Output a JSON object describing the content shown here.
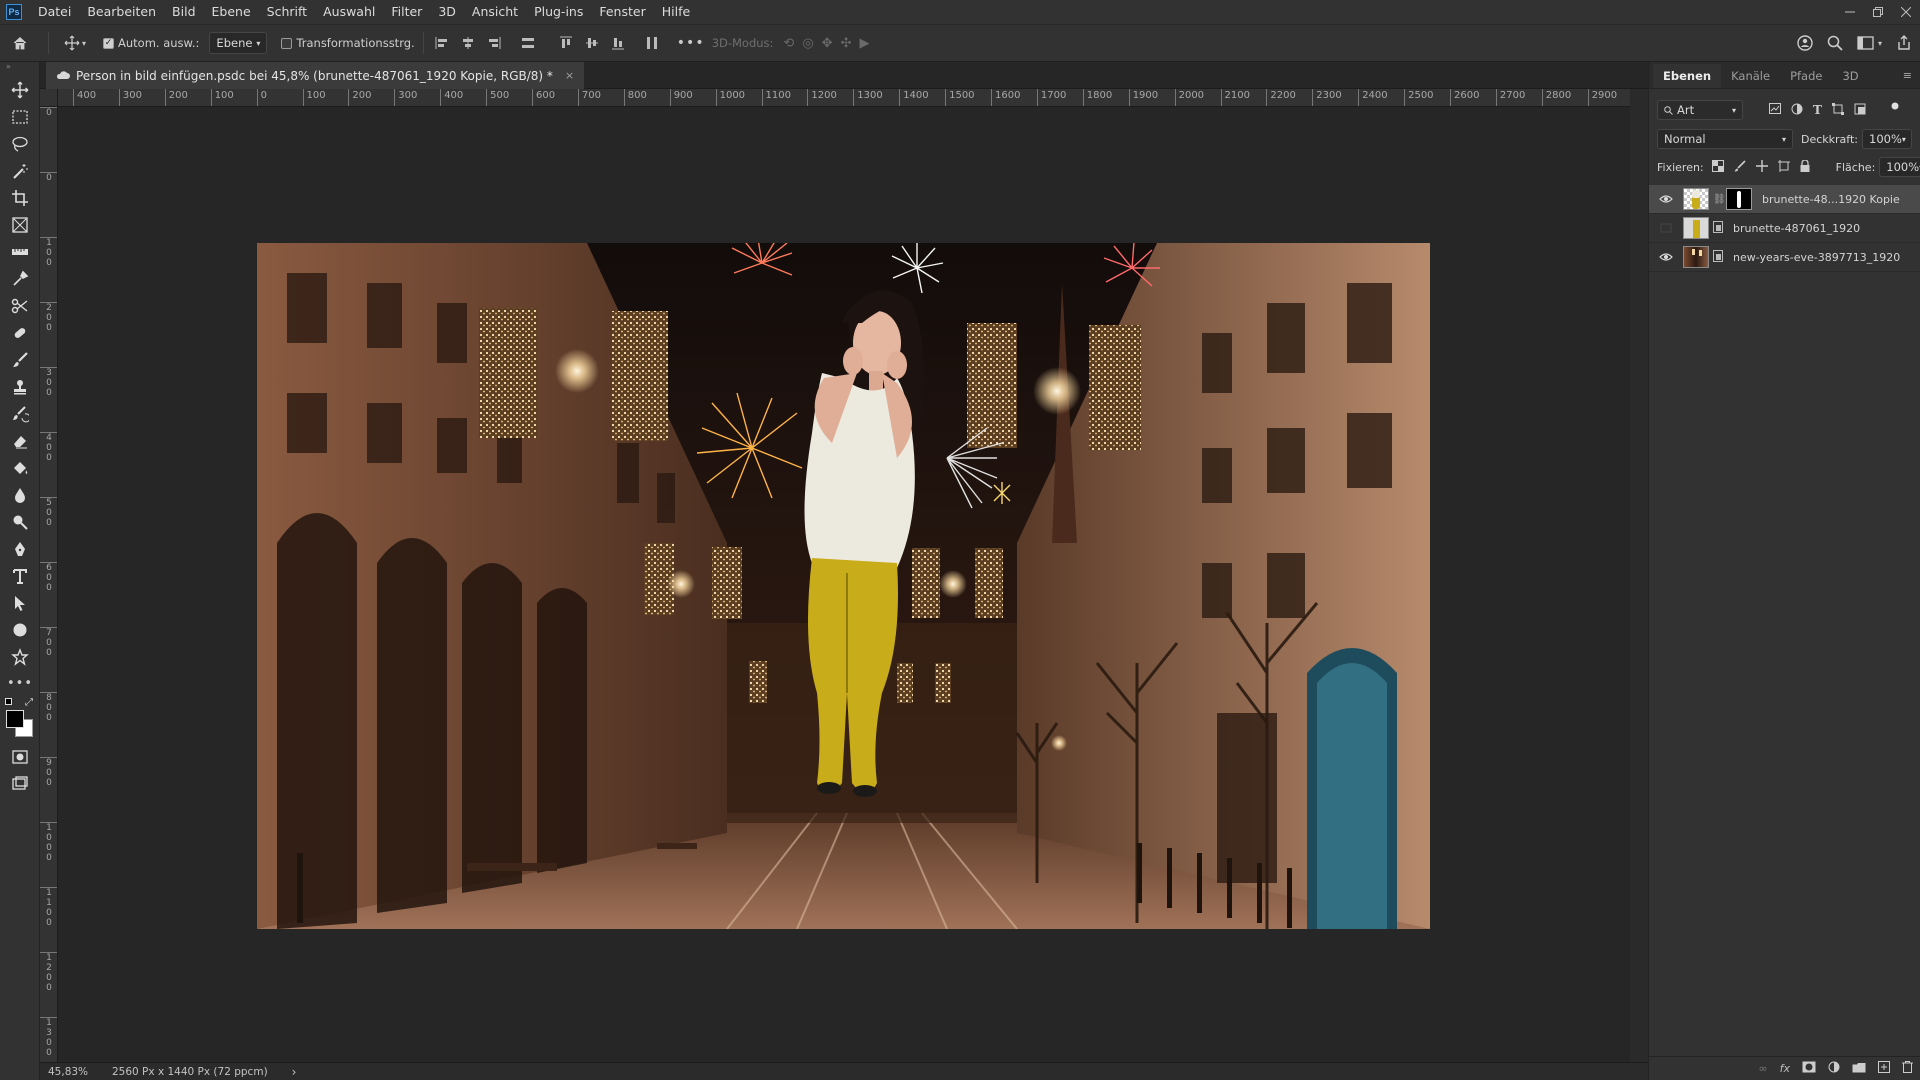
{
  "app": {
    "logo": "Ps",
    "menu": [
      "Datei",
      "Bearbeiten",
      "Bild",
      "Ebene",
      "Schrift",
      "Auswahl",
      "Filter",
      "3D",
      "Ansicht",
      "Plug-ins",
      "Fenster",
      "Hilfe"
    ]
  },
  "options": {
    "auto_select_label": "Autom. ausw.:",
    "auto_select_checked": true,
    "layer_dropdown": "Ebene",
    "transform_label": "Transformationsstrg.",
    "transform_checked": false,
    "mode_3d_label": "3D-Modus:"
  },
  "document": {
    "tab_title": "Person in bild einfügen.psdc bei 45,8% (brunette-487061_1920 Kopie, RGB/8) *",
    "close_glyph": "×"
  },
  "rulers": {
    "horizontal": [
      "400",
      "300",
      "200",
      "100",
      "0",
      "100",
      "200",
      "300",
      "400",
      "500",
      "600",
      "700",
      "800",
      "900",
      "1000",
      "1100",
      "1200",
      "1300",
      "1400",
      "1500",
      "1600",
      "1700",
      "1800",
      "1900",
      "2000",
      "2100",
      "2200",
      "2300",
      "2400",
      "2500",
      "2600",
      "2700",
      "2800",
      "2900"
    ],
    "vertical": [
      "0",
      "0",
      "1\n0\n0",
      "2\n0\n0",
      "3\n0\n0",
      "4\n0\n0",
      "5\n0\n0",
      "6\n0\n0",
      "7\n0\n0",
      "8\n0\n0",
      "9\n0\n0",
      "1\n0\n0\n0",
      "1\n1\n0\n0",
      "1\n2\n0\n0",
      "1\n3\n0\n0"
    ]
  },
  "status": {
    "zoom": "45,83%",
    "doc_size": "2560 Px x 1440 Px (72 ppcm)",
    "arrow": "›"
  },
  "panel": {
    "tabs": [
      "Ebenen",
      "Kanäle",
      "Pfade",
      "3D"
    ],
    "active_tab": 0,
    "filter_kind": "Art",
    "blend_mode": "Normal",
    "opacity_label": "Deckkraft:",
    "opacity_value": "100%",
    "lock_label": "Fixieren:",
    "fill_label": "Fläche:",
    "fill_value": "100%",
    "layers": [
      {
        "name": "brunette-48...1920 Kopie",
        "visible": true,
        "selected": true,
        "has_mask": true
      },
      {
        "name": "brunette-487061_1920",
        "visible": false,
        "selected": false,
        "has_mask": false
      },
      {
        "name": "new-years-eve-3897713_1920",
        "visible": true,
        "selected": false,
        "has_mask": false
      }
    ]
  },
  "colors": {
    "foreground": "#000000",
    "background": "#ffffff",
    "accent": "#3d8fd6"
  }
}
